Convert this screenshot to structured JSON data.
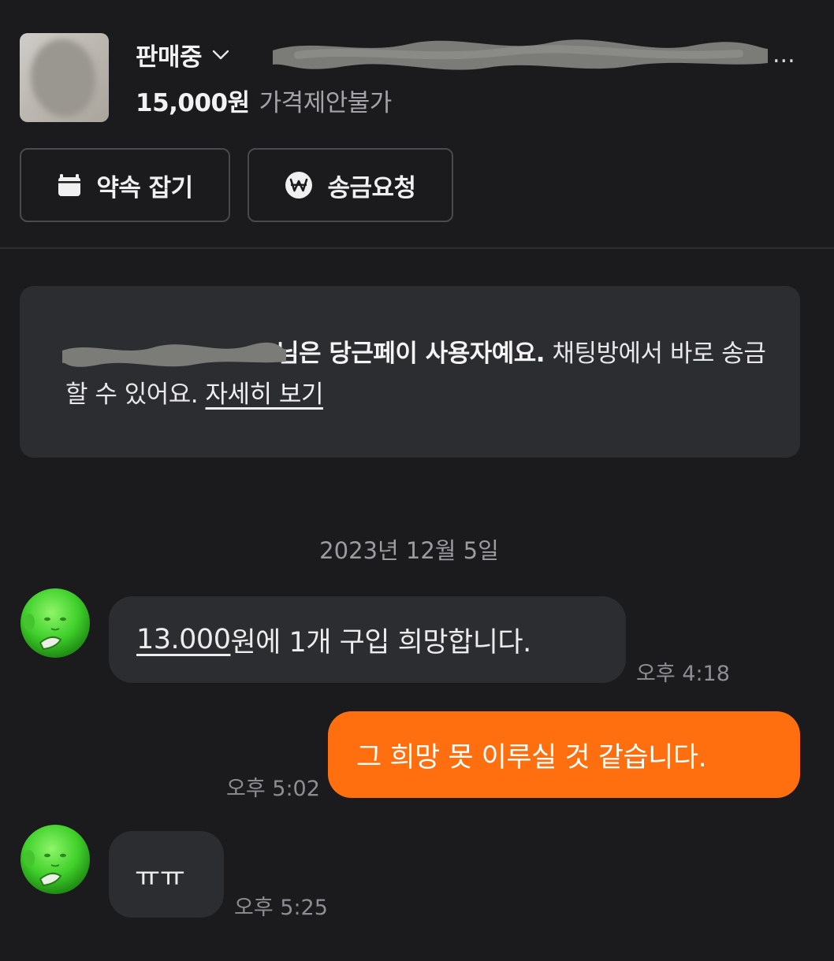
{
  "product": {
    "status": "판매중",
    "title_visible_tail": "...",
    "price": "15,000원",
    "price_note": "가격제안불가"
  },
  "actions": {
    "schedule_label": "약속 잡기",
    "request_label": "송금요청"
  },
  "notice": {
    "suffix_bold": "님은 당근페이 사용자예요.",
    "body": " 채팅방에서 바로 송금할 수 있어요. ",
    "link": "자세히 보기"
  },
  "chat": {
    "date": "2023년 12월 5일",
    "messages": [
      {
        "direction": "incoming",
        "price_mention": "13.000",
        "text_after": "원에 1개 구입 희망합니다.",
        "time": "오후 4:18"
      },
      {
        "direction": "outgoing",
        "text": "그 희망 못 이루실 것 같습니다.",
        "time": "오후 5:02"
      },
      {
        "direction": "incoming",
        "text": "ㅠㅠ",
        "time": "오후 5:25"
      }
    ]
  },
  "colors": {
    "background": "#1b1b1d",
    "card": "#2b2d31",
    "accent": "#ff6f0f",
    "muted_text": "#8e8e92"
  },
  "icons": {
    "status_dropdown": "chevron-down-icon",
    "schedule": "calendar-icon",
    "request": "won-coin-icon"
  }
}
